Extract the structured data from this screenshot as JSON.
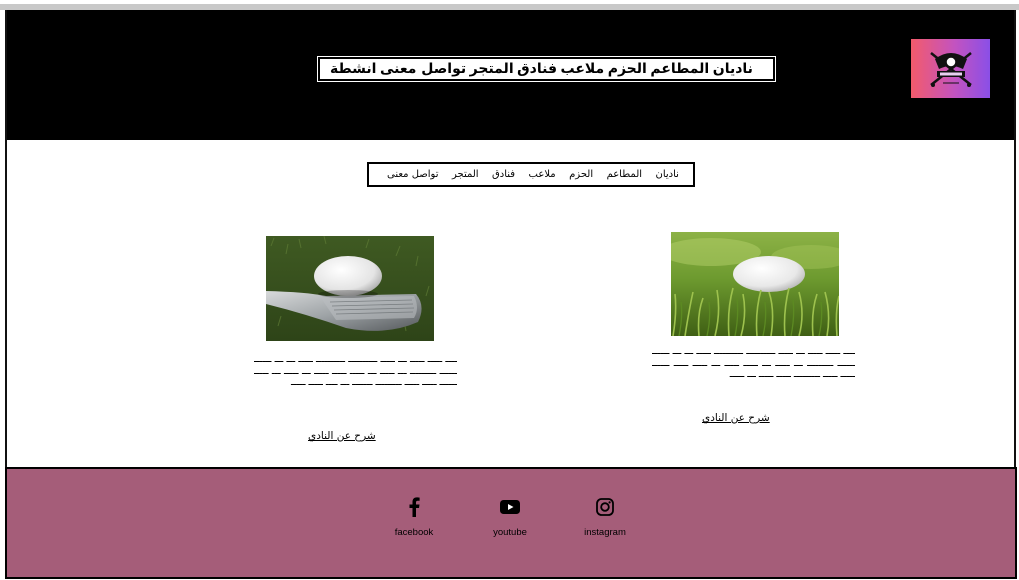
{
  "header": {
    "nav": [
      "ناديان",
      "المطاعم",
      "الحزم",
      "ملاعب",
      "فنادق",
      "المتجر",
      "تواصل معنى",
      "انشطة"
    ],
    "logo_icon": "golf-club-crest-logo"
  },
  "subnav": [
    "ناديان",
    "المطاعم",
    "الحزم",
    "ملاعب",
    "فنادق",
    "المتجر",
    "تواصل معنى"
  ],
  "cards": [
    {
      "image": "golf-ball-on-club-face",
      "blurred_text": "ــــ ـــــ ـــــ ـــ ـــــ ــــــــــ ــــــــــ ـــــ ـــ ـــ ــــــ ــــــ ـــــــــ ـــ ـــــ ـــ ـــــ ـــــ ـــــ ـــ ـــــ ـــ ـــــ ــــــ ـــــ ـــــ ـــــــــ ـــــــ ـــ ــــ ـــــ ـــــ",
      "link": "شرح عن النادي"
    },
    {
      "image": "golf-ball-on-tee-grass",
      "blurred_text": "ــــ ـــــ ـــــ ـــ ـــــ ــــــــــ ــــــــــ ـــــ ـــ ـــ ــــــ ــــــ ـــــــــ ـــ ـــــ ـــ ـــــ ـــــ ـــ ـــــ ـــــ ــــــ ـــــ ـــــ ـــــــــ ـــــ ـــــ ـــ ـــــ",
      "link": "شرح عن النادي"
    }
  ],
  "footer": {
    "background": "#a55d79",
    "social": [
      {
        "icon": "facebook-icon",
        "label": "facebook"
      },
      {
        "icon": "youtube-icon",
        "label": "youtube"
      },
      {
        "icon": "instagram-icon",
        "label": "instagram"
      }
    ]
  }
}
